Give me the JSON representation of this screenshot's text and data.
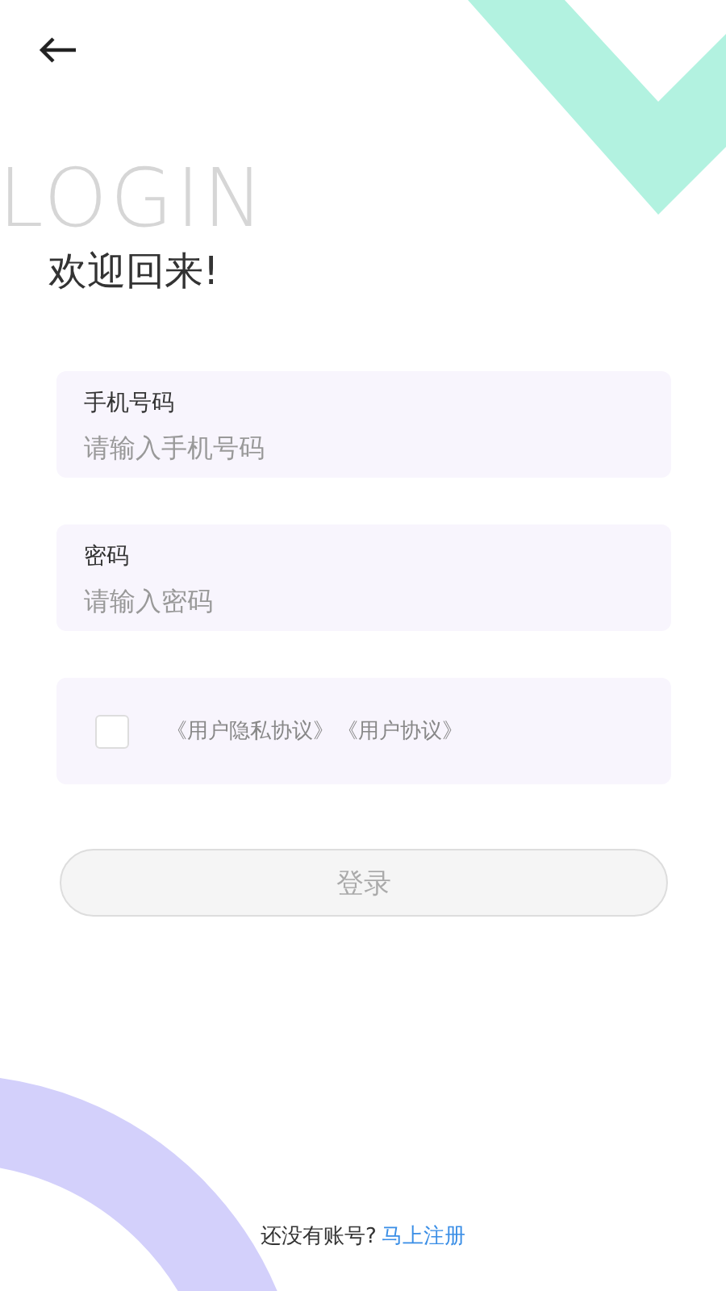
{
  "watermark": "LOGIN",
  "title": "欢迎回来!",
  "fields": [
    {
      "label": "手机号码",
      "placeholder": "请输入手机号码"
    },
    {
      "label": "密码",
      "placeholder": "请输入密码"
    }
  ],
  "agreement": {
    "checked": false,
    "links": [
      "《用户隐私协议》",
      "《用户协议》"
    ]
  },
  "login_button": {
    "label": "登录",
    "disabled": true
  },
  "footer": {
    "text": "还没有账号?",
    "link": "马上注册"
  }
}
